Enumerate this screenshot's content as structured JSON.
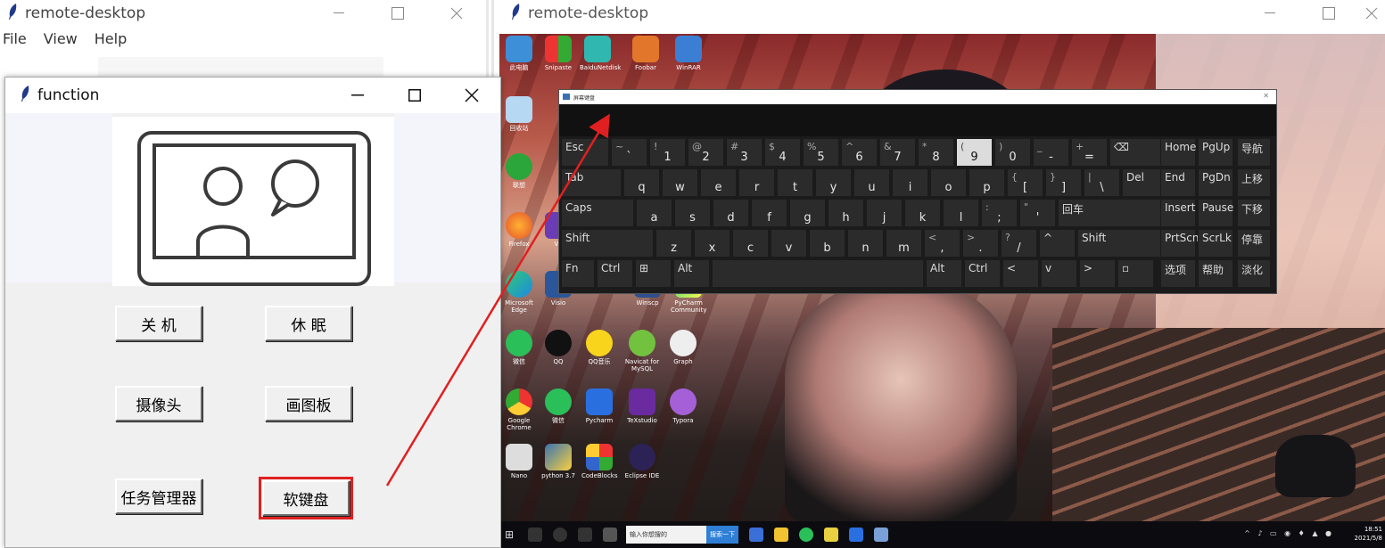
{
  "win1": {
    "title": "remote-desktop",
    "menu": [
      "File",
      "View",
      "Help"
    ]
  },
  "win2": {
    "title": "function",
    "buttons": {
      "shutdown": "关 机",
      "sleep": "休 眠",
      "camera": "摄像头",
      "paint": "画图板",
      "taskmgr": "任务管理器",
      "keyboard": "软键盘"
    }
  },
  "win3": {
    "title": "remote-desktop"
  },
  "desktop_icons": [
    "此电脑",
    "Snipaste",
    "BaiduNetdisk",
    "Foobar",
    "WinRAR",
    "回收站",
    "联想",
    "Firefox",
    "VS",
    "Microsoft Edge",
    "Visio",
    "微信",
    "QQ",
    "QQ音乐",
    "Navicat for MySQL",
    "Graph",
    "Google Chrome",
    "微信",
    "Pycharm",
    "TeXstudio",
    "Typora",
    "Nano",
    "python 3.7",
    "CodeBlocks",
    "Eclipse IDE",
    "Winscp",
    "PyCharm Community"
  ],
  "taskbar": {
    "search_placeholder": "输入你想搜的",
    "search_btn": "搜索一下",
    "clock_time": "18:51",
    "clock_date": "2021/5/8"
  },
  "osk": {
    "title": "屏幕键盘",
    "row1": [
      [
        "Esc",
        ""
      ],
      [
        "~",
        "`"
      ],
      [
        "!",
        "1"
      ],
      [
        "@",
        "2"
      ],
      [
        "#",
        "3"
      ],
      [
        "$",
        "4"
      ],
      [
        "%",
        "5"
      ],
      [
        "^",
        "6"
      ],
      [
        "&",
        "7"
      ],
      [
        "*",
        "8"
      ],
      [
        "(",
        "9"
      ],
      [
        ")",
        "0"
      ],
      [
        "_",
        "-"
      ],
      [
        "+",
        "="
      ],
      [
        "⌫",
        ""
      ]
    ],
    "row2": [
      [
        "Tab",
        ""
      ],
      [
        "",
        "q"
      ],
      [
        "",
        "w"
      ],
      [
        "",
        "e"
      ],
      [
        "",
        "r"
      ],
      [
        "",
        "t"
      ],
      [
        "",
        "y"
      ],
      [
        "",
        "u"
      ],
      [
        "",
        "i"
      ],
      [
        "",
        "o"
      ],
      [
        "",
        "p"
      ],
      [
        "{",
        "["
      ],
      [
        "}",
        "]"
      ],
      [
        "|",
        "\\"
      ],
      [
        "Del",
        ""
      ]
    ],
    "row3": [
      [
        "Caps",
        ""
      ],
      [
        "",
        "a"
      ],
      [
        "",
        "s"
      ],
      [
        "",
        "d"
      ],
      [
        "",
        "f"
      ],
      [
        "",
        "g"
      ],
      [
        "",
        "h"
      ],
      [
        "",
        "j"
      ],
      [
        "",
        "k"
      ],
      [
        "",
        "l"
      ],
      [
        ":",
        ";"
      ],
      [
        "\"",
        "'"
      ],
      [
        "回车",
        ""
      ]
    ],
    "row4": [
      [
        "Shift",
        ""
      ],
      [
        "",
        "z"
      ],
      [
        "",
        "x"
      ],
      [
        "",
        "c"
      ],
      [
        "",
        "v"
      ],
      [
        "",
        "b"
      ],
      [
        "",
        "n"
      ],
      [
        "",
        "m"
      ],
      [
        "<",
        ","
      ],
      [
        ">",
        "."
      ],
      [
        "?",
        "/"
      ],
      [
        "^",
        ""
      ],
      [
        "Shift",
        ""
      ]
    ],
    "row5": [
      [
        "Fn",
        ""
      ],
      [
        "Ctrl",
        ""
      ],
      [
        "⊞",
        ""
      ],
      [
        "Alt",
        ""
      ],
      [
        "",
        ""
      ],
      [
        "Alt",
        ""
      ],
      [
        "Ctrl",
        ""
      ],
      [
        "<",
        ""
      ],
      [
        "v",
        ""
      ],
      [
        ">",
        ""
      ],
      [
        "▫",
        ""
      ]
    ],
    "side": [
      [
        "Home",
        "PgUp",
        "导航"
      ],
      [
        "End",
        "PgDn",
        "上移"
      ],
      [
        "Insert",
        "Pause",
        "下移"
      ],
      [
        "PrtScn",
        "ScrLk",
        "停靠"
      ],
      [
        "选项",
        "帮助",
        "淡化"
      ]
    ]
  }
}
